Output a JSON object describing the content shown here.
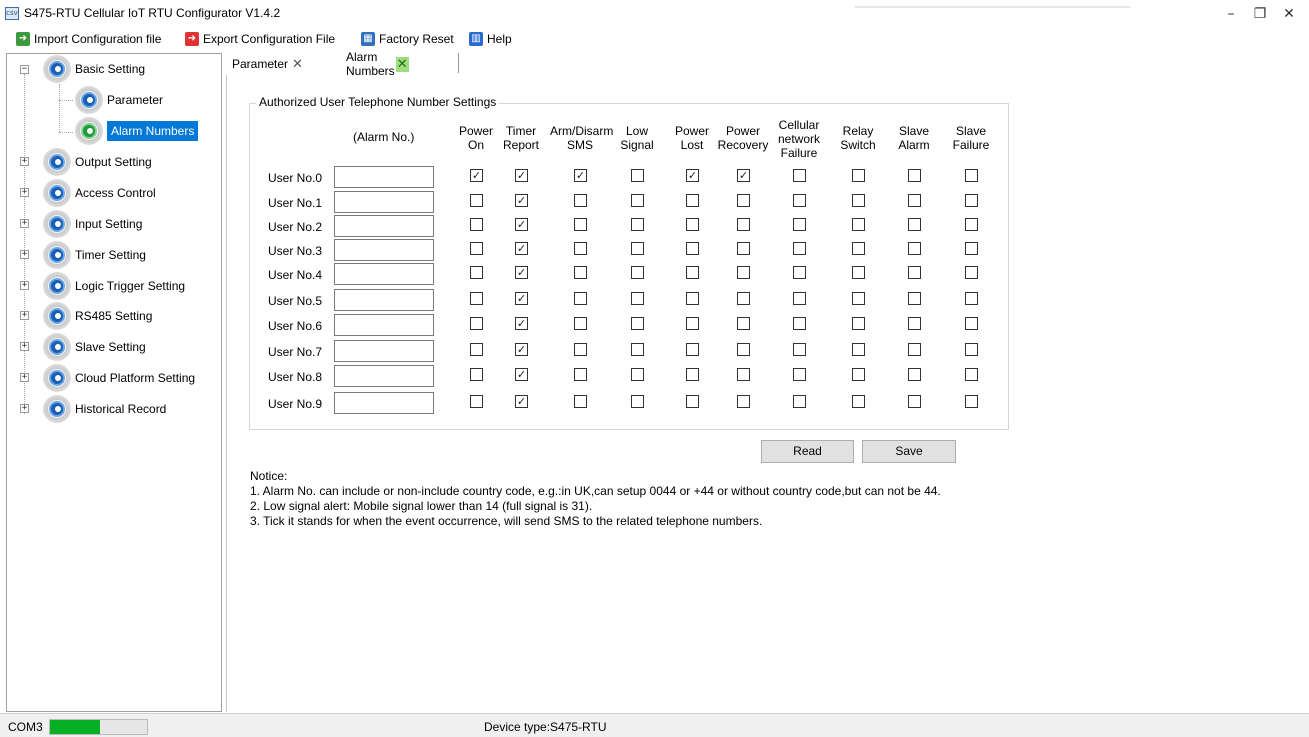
{
  "window": {
    "icon_text": "csv",
    "title": "S475-RTU Cellular IoT RTU Configurator V1.4.2",
    "controls": {
      "minimize": "–",
      "restore": "❐",
      "close": "✕"
    }
  },
  "toolbar": {
    "import_label": "Import Configuration file",
    "export_label": "Export Configuration File",
    "reset_label": "Factory Reset",
    "help_label": "Help"
  },
  "tree": {
    "expand_symbol": "+",
    "collapse_symbol": "−",
    "basic": "Basic Setting",
    "parameter": "Parameter",
    "alarm_numbers": "Alarm Numbers",
    "output": "Output Setting",
    "access": "Access Control",
    "input": "Input Setting",
    "timer": "Timer Setting",
    "logic": "Logic Trigger Setting",
    "rs485": "RS485 Setting",
    "slave": "Slave Setting",
    "cloud": "Cloud Platform Setting",
    "history": "Historical Record"
  },
  "tabs": {
    "parameter": "Parameter",
    "alarm_numbers": "Alarm Numbers",
    "close_symbol": "✕"
  },
  "group": {
    "title": "Authorized User Telephone Number Settings",
    "alarm_no_header": "(Alarm No.)",
    "columns": [
      [
        "Power",
        "On"
      ],
      [
        "Timer",
        "Report"
      ],
      [
        "Arm/Disarm",
        "SMS"
      ],
      [
        "Low",
        "Signal"
      ],
      [
        "Power",
        "Lost"
      ],
      [
        "Power",
        "Recovery"
      ],
      [
        "Cellular",
        "network",
        "Failure"
      ],
      [
        "Relay",
        "Switch"
      ],
      [
        "Slave",
        "Alarm"
      ],
      [
        "Slave",
        "Failure"
      ]
    ],
    "check_symbol": "✓",
    "users": [
      {
        "label": "User No.0",
        "alarm_no": "",
        "checks": [
          true,
          true,
          true,
          false,
          true,
          true,
          false,
          false,
          false,
          false
        ]
      },
      {
        "label": "User No.1",
        "alarm_no": "",
        "checks": [
          false,
          true,
          false,
          false,
          false,
          false,
          false,
          false,
          false,
          false
        ]
      },
      {
        "label": "User No.2",
        "alarm_no": "",
        "checks": [
          false,
          true,
          false,
          false,
          false,
          false,
          false,
          false,
          false,
          false
        ]
      },
      {
        "label": "User No.3",
        "alarm_no": "",
        "checks": [
          false,
          true,
          false,
          false,
          false,
          false,
          false,
          false,
          false,
          false
        ]
      },
      {
        "label": "User No.4",
        "alarm_no": "",
        "checks": [
          false,
          true,
          false,
          false,
          false,
          false,
          false,
          false,
          false,
          false
        ]
      },
      {
        "label": "User No.5",
        "alarm_no": "",
        "checks": [
          false,
          true,
          false,
          false,
          false,
          false,
          false,
          false,
          false,
          false
        ]
      },
      {
        "label": "User No.6",
        "alarm_no": "",
        "checks": [
          false,
          true,
          false,
          false,
          false,
          false,
          false,
          false,
          false,
          false
        ]
      },
      {
        "label": "User No.7",
        "alarm_no": "",
        "checks": [
          false,
          true,
          false,
          false,
          false,
          false,
          false,
          false,
          false,
          false
        ]
      },
      {
        "label": "User No.8",
        "alarm_no": "",
        "checks": [
          false,
          true,
          false,
          false,
          false,
          false,
          false,
          false,
          false,
          false
        ]
      },
      {
        "label": "User No.9",
        "alarm_no": "",
        "checks": [
          false,
          true,
          false,
          false,
          false,
          false,
          false,
          false,
          false,
          false
        ]
      }
    ]
  },
  "buttons": {
    "read": "Read",
    "save": "Save"
  },
  "notice": {
    "heading": "Notice:",
    "lines": [
      "1. Alarm No. can include or non-include country code, e.g.:in UK,can setup 0044 or +44 or without country code,but can not be 44.",
      "2. Low signal alert: Mobile signal lower than 14 (full signal is 31).",
      "3. Tick it stands for when the event occurrence, will send SMS to the related telephone numbers."
    ]
  },
  "status": {
    "port": "COM3",
    "progress": 0.52,
    "device": "Device type:S475-RTU",
    "progress_color": "#06b025"
  },
  "colors": {
    "selection": "#0078d7",
    "gear_blue": "#1a5fb4",
    "gear_green": "#1d9b3a"
  }
}
